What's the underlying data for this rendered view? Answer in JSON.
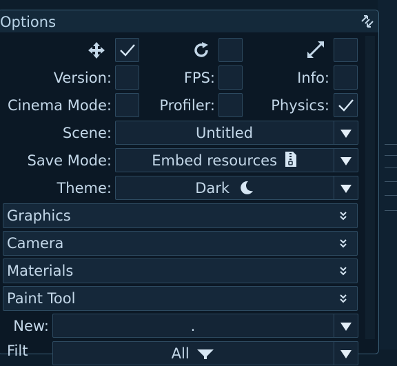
{
  "panel": {
    "title": "Options",
    "resize_icon": "resize-diagonal-icon"
  },
  "toolbar_row": {
    "move_icon": "move-arrows-icon",
    "reset_icon": "rotate-reset-icon",
    "expand_icon": "expand-diagonal-icon",
    "move_checked": true,
    "reset_checked": false,
    "expand_checked": false
  },
  "toggles": {
    "version_label": "Version:",
    "fps_label": "FPS:",
    "info_label": "Info:",
    "cinema_label": "Cinema Mode:",
    "profiler_label": "Profiler:",
    "physics_label": "Physics:",
    "version_checked": false,
    "fps_checked": false,
    "info_checked": false,
    "cinema_checked": false,
    "profiler_checked": false,
    "physics_checked": true
  },
  "scene": {
    "label": "Scene:",
    "value": "Untitled"
  },
  "save_mode": {
    "label": "Save Mode:",
    "value": "Embed resources",
    "icon": "zip-file-icon"
  },
  "theme": {
    "label": "Theme:",
    "value": "Dark",
    "icon": "moon-icon"
  },
  "sections": [
    {
      "label": "Graphics"
    },
    {
      "label": "Camera"
    },
    {
      "label": "Materials"
    },
    {
      "label": "Paint Tool"
    }
  ],
  "paint_tool": {
    "new_label": "New:",
    "new_value": ".",
    "filter_label_partial": "Filt",
    "filter_value_partial": "All"
  },
  "colors": {
    "background": "#0d1d2b",
    "panel": "#0b1825",
    "border": "#2d4a60",
    "text": "#c3d7e8",
    "icon": "#e3eef7"
  }
}
